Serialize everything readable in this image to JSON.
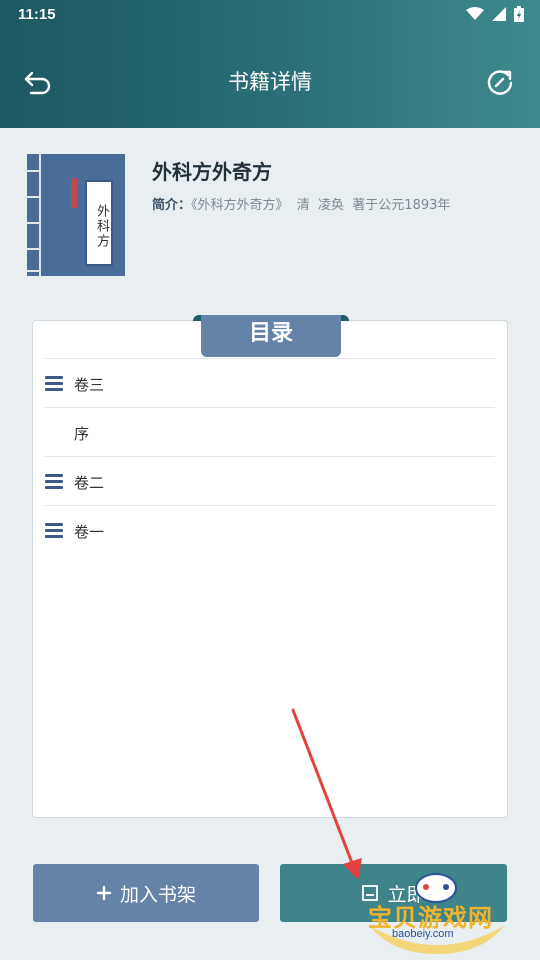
{
  "status": {
    "time": "11:15"
  },
  "header": {
    "title": "书籍详情",
    "back_icon": "back-arrow-icon",
    "refresh_icon": "refresh-icon"
  },
  "book": {
    "title": "外科方外奇方",
    "cover_text": "外科方",
    "desc_label": "简介：",
    "desc_text": "《外科方外奇方》  清  凌奂  著于公元1893年"
  },
  "toc": {
    "title": "目录",
    "items": [
      {
        "label": "卷三",
        "has_children": true
      },
      {
        "label": "序",
        "has_children": false
      },
      {
        "label": "卷二",
        "has_children": true
      },
      {
        "label": "卷一",
        "has_children": true
      }
    ]
  },
  "actions": {
    "bookshelf_label": "加入书架",
    "read_label": "立即"
  },
  "watermark": {
    "text": "宝贝游戏网",
    "url": "baobeiy.com"
  },
  "colors": {
    "header_start": "#1c5862",
    "header_end": "#3e8a8c",
    "accent_blue": "#6583a8",
    "accent_teal": "#3f8489"
  }
}
